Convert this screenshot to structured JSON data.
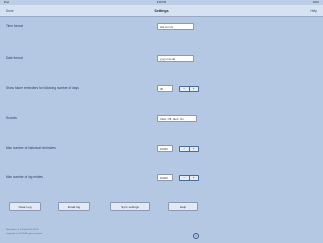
{
  "statusbar": {
    "left": "iPad",
    "time": "8:08 PM",
    "right": "100%"
  },
  "navbar": {
    "left": "Done",
    "title": "Settings",
    "right": "Help"
  },
  "settings": {
    "time_format": {
      "label": "Time format",
      "value": "HH:mm:ss"
    },
    "date_format": {
      "label": "Date format",
      "value": "yyyy-mm-dd"
    },
    "future_days": {
      "label": "Show future reminders for following number of days",
      "value": "30",
      "minus": "−",
      "plus": "+"
    },
    "sounds": {
      "label": "Sounds",
      "value": "Click, Off, Alert, On"
    },
    "max_historical": {
      "label": "Max number of historical reminders",
      "value": "10000",
      "minus": "−",
      "plus": "+"
    },
    "max_log": {
      "label": "Max number of log entries",
      "value": "10000",
      "minus": "−",
      "plus": "+"
    }
  },
  "buttons": {
    "clear_log": "Clear Log",
    "email_log": "Email log",
    "sync_settings": "Sync settings",
    "help": "Help"
  },
  "footer": {
    "line1": "Reminders v1.4 build 2012-10-16",
    "line2": "Copyright (c) 2012 All rights reserved"
  },
  "icons": {
    "info": "info-icon"
  }
}
